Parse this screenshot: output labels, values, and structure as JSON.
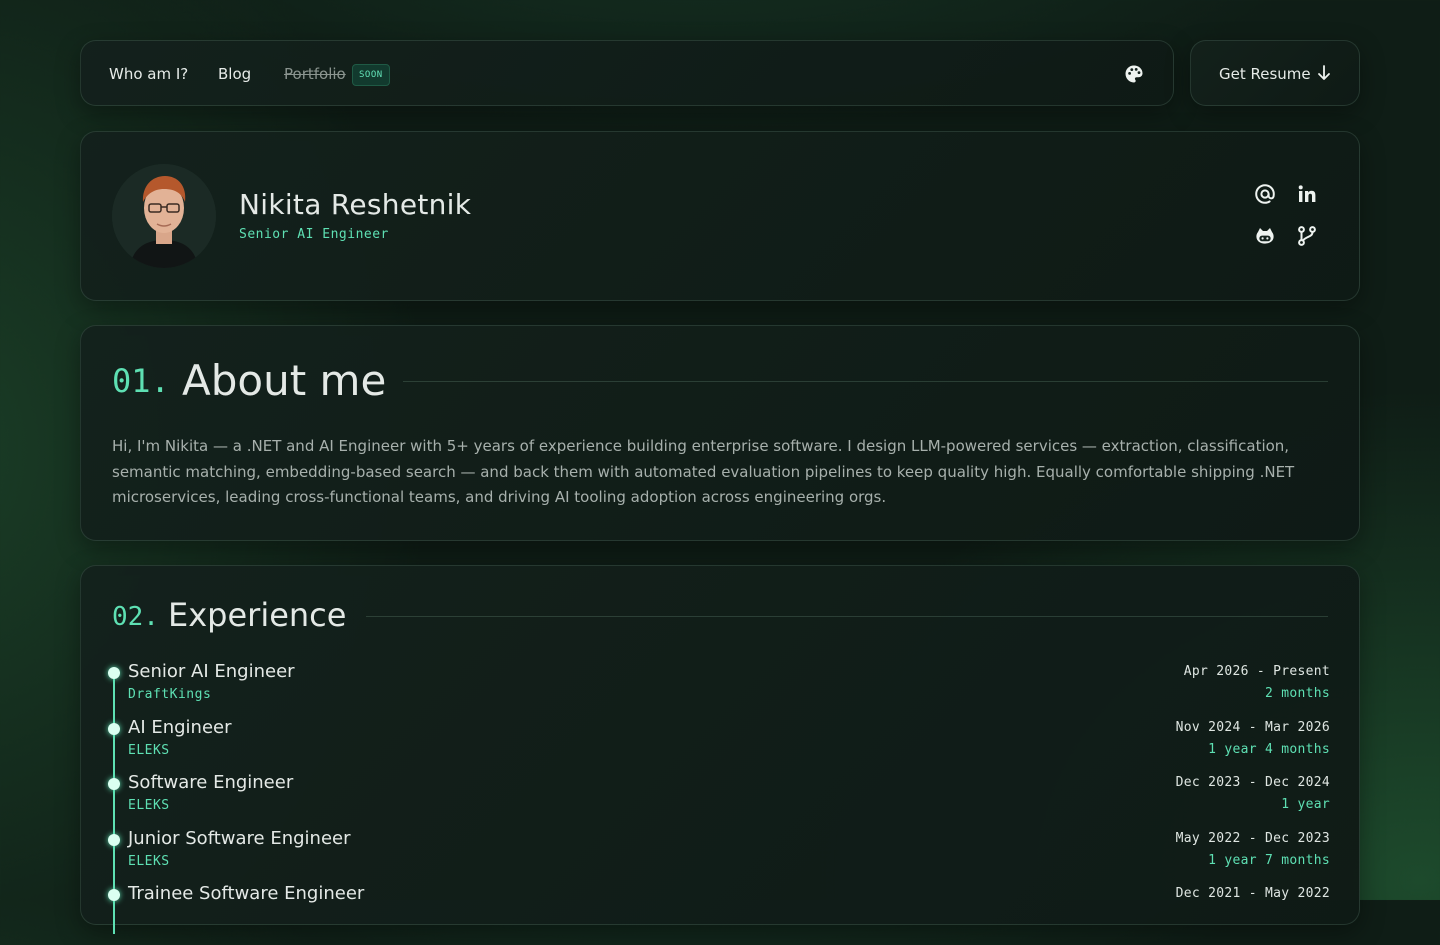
{
  "nav": {
    "items": [
      {
        "label": "Who am I?"
      },
      {
        "label": "Blog"
      },
      {
        "label": "Portfolio",
        "badge": "SOON"
      }
    ],
    "theme_icon": "palette-icon",
    "resume_label": "Get Resume",
    "resume_icon": "arrow-down-icon"
  },
  "profile": {
    "name": "Nikita Reshetnik",
    "role": "Senior AI Engineer",
    "socials": [
      "email-icon",
      "linkedin-icon",
      "github-icon",
      "git-branch-icon"
    ]
  },
  "about": {
    "number": "01.",
    "title": "About me",
    "text": "Hi, I'm Nikita — a .NET and AI Engineer with 5+ years of experience building enterprise software. I design LLM-powered services — extraction, classification, semantic matching, embedding-based search — and back them with automated evaluation pipelines to keep quality high. Equally comfortable shipping .NET microservices, leading cross-functional teams, and driving AI tooling adoption across engineering orgs."
  },
  "experience": {
    "number": "02.",
    "title": "Experience",
    "jobs": [
      {
        "title": "Senior AI Engineer",
        "company": "DraftKings",
        "dates": "Apr 2026 - Present",
        "duration": "2 months"
      },
      {
        "title": "AI Engineer",
        "company": "ELEKS",
        "dates": "Nov 2024 - Mar 2026",
        "duration": "1 year 4 months"
      },
      {
        "title": "Software Engineer",
        "company": "ELEKS",
        "dates": "Dec 2023 - Dec 2024",
        "duration": "1 year"
      },
      {
        "title": "Junior Software Engineer",
        "company": "ELEKS",
        "dates": "May 2022 - Dec 2023",
        "duration": "1 year 7 months"
      },
      {
        "title": "Trainee Software Engineer",
        "company": "",
        "dates": "Dec 2021 - May 2022",
        "duration": ""
      }
    ]
  },
  "colors": {
    "accent": "#5ee0b3",
    "background": "#0f1d16",
    "card": "#13211c",
    "text": "#e4e9e6",
    "muted": "#a7b0ac"
  }
}
